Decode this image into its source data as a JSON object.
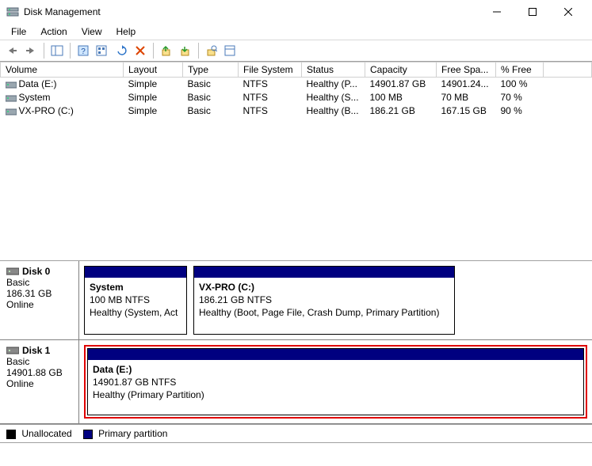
{
  "window": {
    "title": "Disk Management"
  },
  "menu": {
    "file": "File",
    "action": "Action",
    "view": "View",
    "help": "Help"
  },
  "columns": {
    "volume": "Volume",
    "layout": "Layout",
    "type": "Type",
    "filesystem": "File System",
    "status": "Status",
    "capacity": "Capacity",
    "freespace": "Free Spa...",
    "pctfree": "% Free"
  },
  "volumes": [
    {
      "name": "Data (E:)",
      "layout": "Simple",
      "type": "Basic",
      "fs": "NTFS",
      "status": "Healthy (P...",
      "capacity": "14901.87 GB",
      "free": "14901.24...",
      "pct": "100 %"
    },
    {
      "name": "System",
      "layout": "Simple",
      "type": "Basic",
      "fs": "NTFS",
      "status": "Healthy (S...",
      "capacity": "100 MB",
      "free": "70 MB",
      "pct": "70 %"
    },
    {
      "name": "VX-PRO (C:)",
      "layout": "Simple",
      "type": "Basic",
      "fs": "NTFS",
      "status": "Healthy (B...",
      "capacity": "186.21 GB",
      "free": "167.15 GB",
      "pct": "90 %"
    }
  ],
  "disks": {
    "d0": {
      "name": "Disk 0",
      "type": "Basic",
      "size": "186.31 GB",
      "state": "Online",
      "p0": {
        "name": "System",
        "size": "100 MB NTFS",
        "status": "Healthy (System, Act"
      },
      "p1": {
        "name": "VX-PRO  (C:)",
        "size": "186.21 GB NTFS",
        "status": "Healthy (Boot, Page File, Crash Dump, Primary Partition)"
      }
    },
    "d1": {
      "name": "Disk 1",
      "type": "Basic",
      "size": "14901.88 GB",
      "state": "Online",
      "p0": {
        "name": "Data  (E:)",
        "size": "14901.87 GB NTFS",
        "status": "Healthy (Primary Partition)"
      }
    }
  },
  "legend": {
    "unallocated": "Unallocated",
    "primary": "Primary partition"
  }
}
